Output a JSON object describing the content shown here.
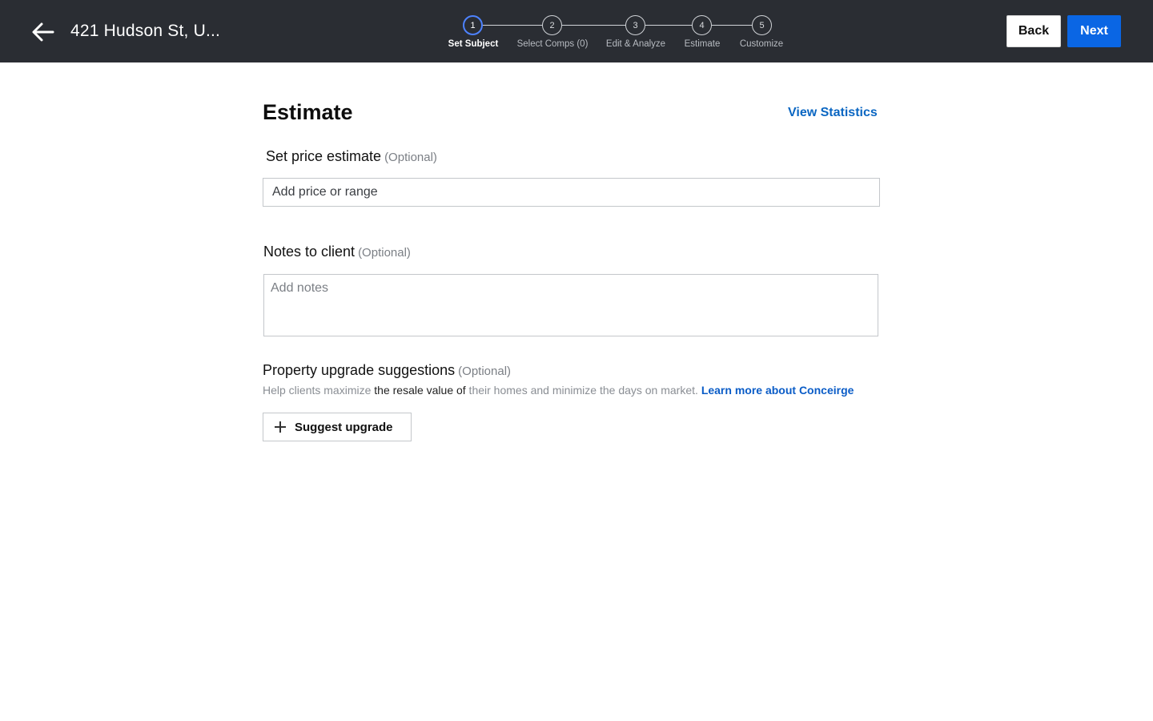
{
  "header": {
    "address": "421 Hudson St,  U...",
    "back_label": "Back",
    "next_label": "Next"
  },
  "stepper": {
    "active_step": 1,
    "steps": [
      {
        "number": "1",
        "label": "Set Subject"
      },
      {
        "number": "2",
        "label": "Select Comps (0)"
      },
      {
        "number": "3",
        "label": "Edit & Analyze"
      },
      {
        "number": "4",
        "label": "Estimate"
      },
      {
        "number": "5",
        "label": "Customize"
      }
    ]
  },
  "main": {
    "title": "Estimate",
    "view_statistics": "View Statistics",
    "price": {
      "label": "Set price estimate",
      "optional": "(Optional)",
      "placeholder": "Add price or range"
    },
    "notes": {
      "label": "Notes to client",
      "optional": "(Optional)",
      "placeholder": "Add notes"
    },
    "upgrades": {
      "label": "Property upgrade suggestions",
      "optional": "(Optional)",
      "help_1": "Help clients maximize ",
      "help_2": "the resale value of",
      "help_3": " their homes and minimize the days on market. ",
      "learn_more": "Learn more about Conceirge",
      "button_label": "Suggest upgrade"
    }
  },
  "colors": {
    "header_bg": "#2a2d33",
    "accent": "#0a66e4",
    "link": "#0a66c2",
    "active_step_ring": "#4d82ff"
  }
}
